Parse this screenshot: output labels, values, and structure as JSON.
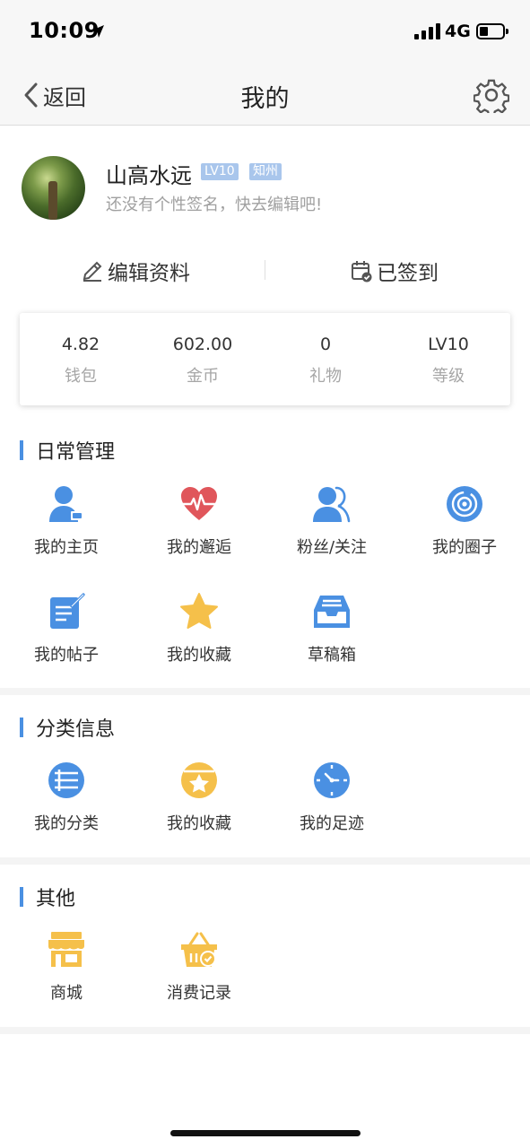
{
  "status_bar": {
    "time": "10:09",
    "network": "4G"
  },
  "nav": {
    "back_label": "返回",
    "title": "我的"
  },
  "profile": {
    "name": "山高水远",
    "level_badge": "LV10",
    "city_badge": "知州",
    "signature": "还没有个性签名，快去编辑吧!"
  },
  "actions": {
    "edit": "编辑资料",
    "checkin": "已签到"
  },
  "stats": [
    {
      "value": "4.82",
      "label": "钱包"
    },
    {
      "value": "602.00",
      "label": "金币"
    },
    {
      "value": "0",
      "label": "礼物"
    },
    {
      "value": "LV10",
      "label": "等级"
    }
  ],
  "daily": {
    "title": "日常管理",
    "items": [
      {
        "label": "我的主页",
        "icon": "user-home-icon"
      },
      {
        "label": "我的邂逅",
        "icon": "heartbeat-icon"
      },
      {
        "label": "粉丝/关注",
        "icon": "followers-icon"
      },
      {
        "label": "我的圈子",
        "icon": "circle-target-icon"
      },
      {
        "label": "我的帖子",
        "icon": "post-edit-icon"
      },
      {
        "label": "我的收藏",
        "icon": "star-icon"
      },
      {
        "label": "草稿箱",
        "icon": "drafts-tray-icon"
      }
    ]
  },
  "category": {
    "title": "分类信息",
    "items": [
      {
        "label": "我的分类",
        "icon": "list-icon"
      },
      {
        "label": "我的收藏",
        "icon": "favorite-box-icon"
      },
      {
        "label": "我的足迹",
        "icon": "clock-icon"
      }
    ]
  },
  "other": {
    "title": "其他",
    "items": [
      {
        "label": "商城",
        "icon": "shop-icon"
      },
      {
        "label": "消费记录",
        "icon": "shopping-basket-icon"
      }
    ]
  },
  "colors": {
    "accent": "#4a90e2",
    "icon_blue": "#4a90e2",
    "icon_red": "#e0565b",
    "icon_yellow": "#f5c04a",
    "badge": "#a9c6ec"
  }
}
